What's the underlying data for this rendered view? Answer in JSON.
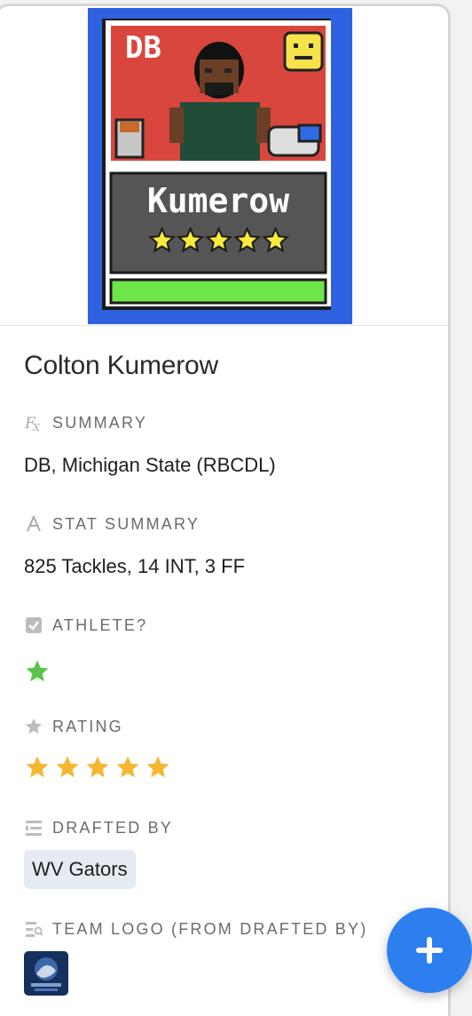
{
  "record": {
    "title": "Colton Kumerow",
    "card_art": {
      "position": "DB",
      "name": "Kumerow",
      "stars": 5,
      "colors": {
        "frame": "#2f62e0",
        "top": "#d9463e",
        "nameplate": "#555555",
        "bar": "#6ee64a"
      }
    },
    "fields": {
      "summary": {
        "label": "SUMMARY",
        "icon": "formula-icon",
        "value": "DB, Michigan State (RBCDL)"
      },
      "stat_summary": {
        "label": "STAT SUMMARY",
        "icon": "text-icon",
        "value": "825 Tackles, 14 INT, 3 FF"
      },
      "athlete": {
        "label": "ATHLETE?",
        "icon": "checkbox-icon",
        "checked": true
      },
      "rating": {
        "label": "RATING",
        "icon": "star-icon",
        "value": 5,
        "max": 5
      },
      "drafted_by": {
        "label": "DRAFTED BY",
        "icon": "link-icon",
        "value": "WV Gators"
      },
      "team_logo": {
        "label": "TEAM LOGO (FROM DRAFTED BY)",
        "icon": "lookup-icon"
      }
    }
  },
  "fab": {
    "icon": "plus-icon"
  },
  "colors": {
    "accent": "#2d7ff0",
    "star": "#f5b731",
    "check_star": "#5ac44a"
  }
}
